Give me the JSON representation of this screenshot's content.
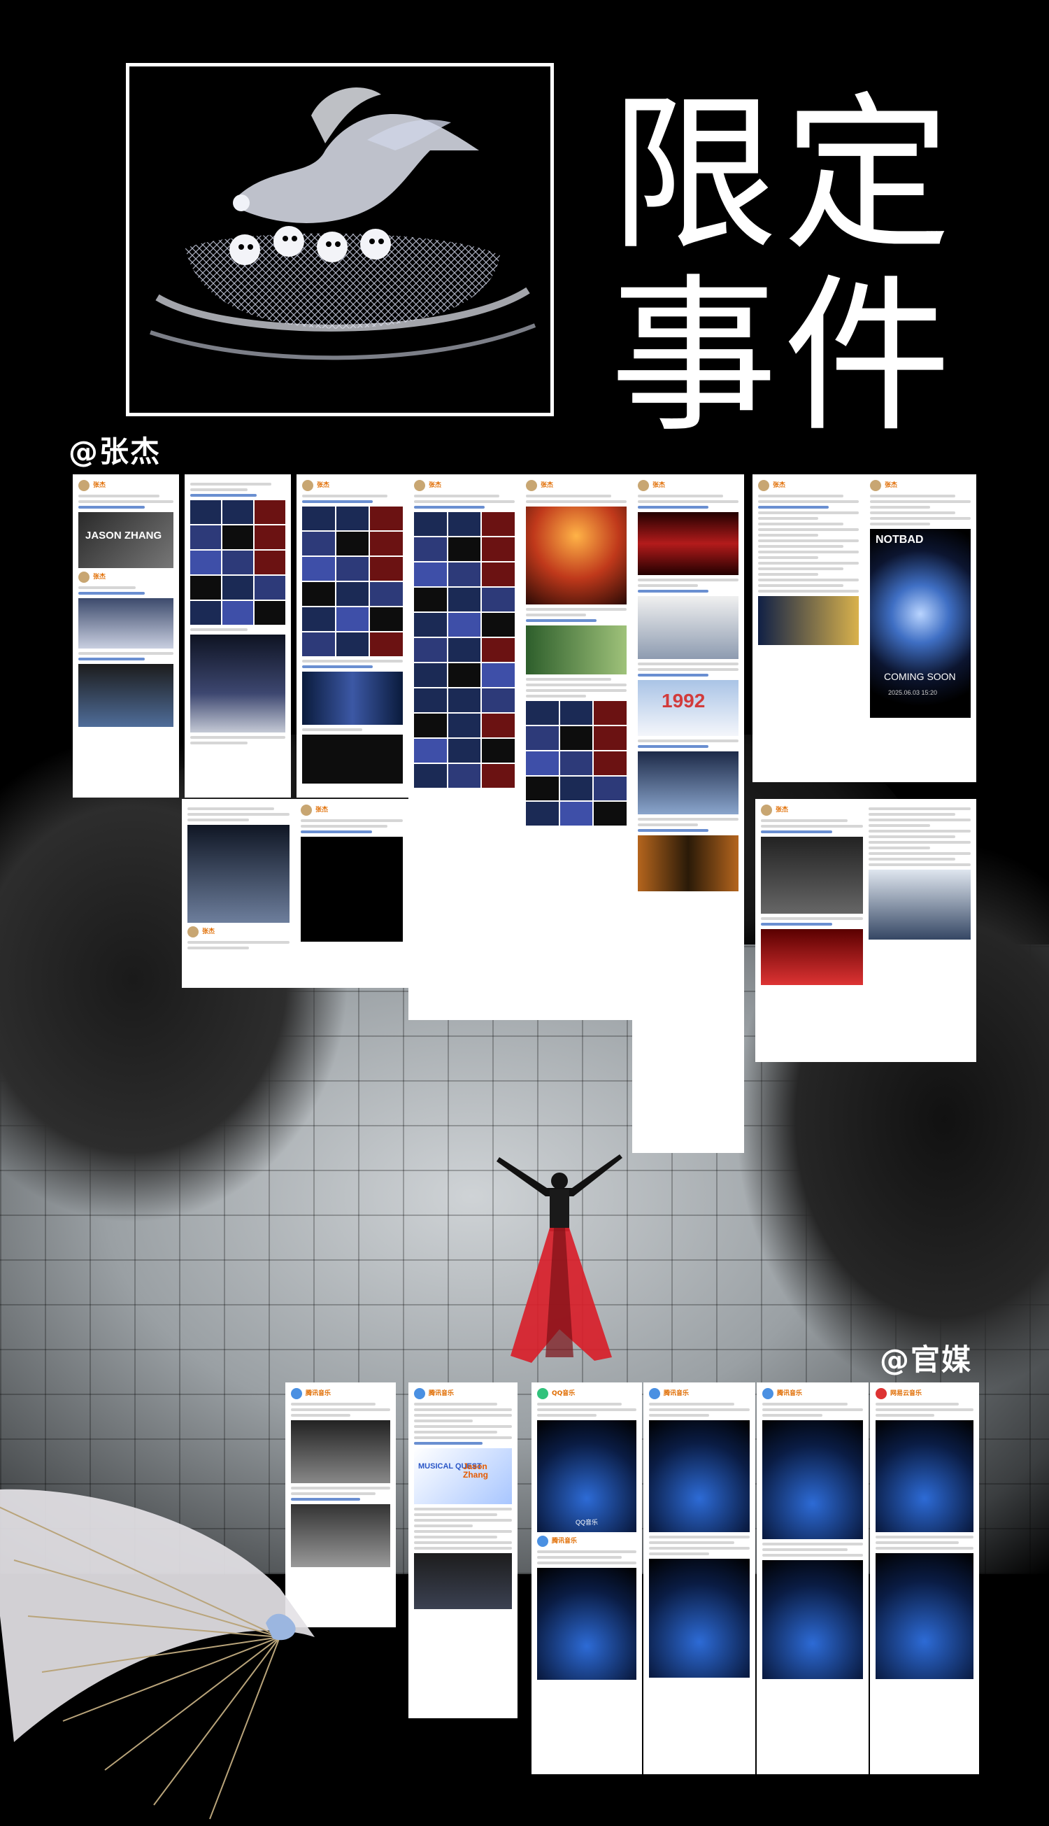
{
  "title": {
    "line1": "限定",
    "line2": "事件"
  },
  "handles": {
    "artist": "@张杰",
    "media": "@官媒"
  },
  "cards": {
    "artist_name": "张杰",
    "jason_banner": "JASON ZHANG",
    "numbers_banner": "1992",
    "notbad_brand": "NOTBAD",
    "coming_soon": "COMING SOON",
    "coming_date": "2025.06.03 15:20",
    "musical_quest": "MUSICAL QUEST",
    "jason_zhang": "Jason Zhang",
    "qq_music": "QQ音乐",
    "media_names": [
      "腾讯音乐",
      "QQ音乐",
      "腾讯音乐",
      "腾讯音乐",
      "网易云音乐"
    ]
  },
  "colors": {
    "accent_orange": "#e06c00",
    "tag_blue": "#6a8fd1",
    "dress_red": "#d8202a"
  }
}
